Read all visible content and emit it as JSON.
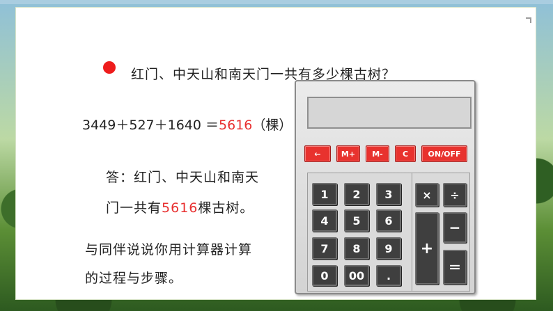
{
  "question": "红门、中天山和南天门一共有多少棵古树？",
  "equation": {
    "expression": "3449＋527＋1640 ＝",
    "result": "5616",
    "unit": "（棵）"
  },
  "answer": {
    "line1": "答：红门、中天山和南天",
    "line2_prefix": "门一共有",
    "line2_number": "5616",
    "line2_suffix": "棵古树。"
  },
  "tip": {
    "line1": "与同伴说说你用计算器计算",
    "line2": "的过程与步骤。"
  },
  "calculator": {
    "display_value": "",
    "function_keys": [
      "←",
      "M+",
      "M-",
      "C",
      "ON/OFF"
    ],
    "number_keys": [
      "1",
      "2",
      "3",
      "4",
      "5",
      "6",
      "7",
      "8",
      "9",
      "0",
      "00",
      "."
    ],
    "operator_keys": [
      "×",
      "÷",
      "+",
      "−",
      "＝"
    ]
  },
  "colors": {
    "accent_red": "#e83030",
    "function_key": "#e8322e",
    "number_key": "#3f3f3f"
  }
}
